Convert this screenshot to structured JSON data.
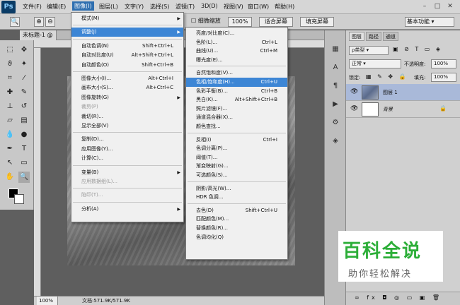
{
  "app": {
    "logo": "Ps"
  },
  "menubar": {
    "items": [
      "文件(F)",
      "编辑(E)",
      "图像(I)",
      "图层(L)",
      "文字(Y)",
      "选择(S)",
      "滤镜(T)",
      "3D(D)",
      "视图(V)",
      "窗口(W)",
      "帮助(H)"
    ],
    "active_index": 2
  },
  "optbar": {
    "zoom_value": "100%",
    "fine_zoom_label": "细微缩放",
    "fit_screen": "适合屏幕",
    "fill_screen": "填充屏幕",
    "workspace": "基本功能"
  },
  "document": {
    "tab_title": "未标题-1 @",
    "zoom": "100%",
    "doc_info": "文档:571.9K/571.9K"
  },
  "image_menu": {
    "items": [
      {
        "label": "模式(M)",
        "shortcut": "",
        "submenu": true,
        "disabled": false
      },
      {
        "sep": true
      },
      {
        "label": "调整(J)",
        "shortcut": "",
        "submenu": true,
        "disabled": false,
        "highlight": true
      },
      {
        "sep": true
      },
      {
        "label": "自动色调(N)",
        "shortcut": "Shift+Ctrl+L",
        "disabled": false
      },
      {
        "label": "自动对比度(U)",
        "shortcut": "Alt+Shift+Ctrl+L",
        "disabled": false
      },
      {
        "label": "自动颜色(O)",
        "shortcut": "Shift+Ctrl+B",
        "disabled": false
      },
      {
        "sep": true
      },
      {
        "label": "图像大小(I)...",
        "shortcut": "Alt+Ctrl+I",
        "disabled": false
      },
      {
        "label": "画布大小(S)...",
        "shortcut": "Alt+Ctrl+C",
        "disabled": false
      },
      {
        "label": "图像旋转(G)",
        "shortcut": "",
        "submenu": true,
        "disabled": false
      },
      {
        "label": "裁剪(P)",
        "shortcut": "",
        "disabled": true
      },
      {
        "label": "裁切(R)...",
        "shortcut": "",
        "disabled": false
      },
      {
        "label": "显示全部(V)",
        "shortcut": "",
        "disabled": false
      },
      {
        "sep": true
      },
      {
        "label": "复制(D)...",
        "shortcut": "",
        "disabled": false
      },
      {
        "label": "应用图像(Y)...",
        "shortcut": "",
        "disabled": false
      },
      {
        "label": "计算(C)...",
        "shortcut": "",
        "disabled": false
      },
      {
        "sep": true
      },
      {
        "label": "变量(B)",
        "shortcut": "",
        "submenu": true,
        "disabled": false
      },
      {
        "label": "应用数据组(L)...",
        "shortcut": "",
        "disabled": true
      },
      {
        "sep": true
      },
      {
        "label": "陷印(T)...",
        "shortcut": "",
        "disabled": true
      },
      {
        "sep": true
      },
      {
        "label": "分析(A)",
        "shortcut": "",
        "submenu": true,
        "disabled": false
      }
    ]
  },
  "adjust_menu": {
    "items": [
      {
        "label": "亮度/对比度(C)...",
        "shortcut": ""
      },
      {
        "label": "色阶(L)...",
        "shortcut": "Ctrl+L"
      },
      {
        "label": "曲线(U)...",
        "shortcut": "Ctrl+M"
      },
      {
        "label": "曝光度(E)...",
        "shortcut": ""
      },
      {
        "sep": true
      },
      {
        "label": "自然饱和度(V)...",
        "shortcut": ""
      },
      {
        "label": "色相/饱和度(H)...",
        "shortcut": "Ctrl+U",
        "highlight": true
      },
      {
        "label": "色彩平衡(B)...",
        "shortcut": "Ctrl+B"
      },
      {
        "label": "黑白(K)...",
        "shortcut": "Alt+Shift+Ctrl+B"
      },
      {
        "label": "照片滤镜(F)...",
        "shortcut": ""
      },
      {
        "label": "通道混合器(X)...",
        "shortcut": ""
      },
      {
        "label": "颜色查找...",
        "shortcut": ""
      },
      {
        "sep": true
      },
      {
        "label": "反相(I)",
        "shortcut": "Ctrl+I"
      },
      {
        "label": "色调分离(P)...",
        "shortcut": ""
      },
      {
        "label": "阈值(T)...",
        "shortcut": ""
      },
      {
        "label": "渐变映射(G)...",
        "shortcut": ""
      },
      {
        "label": "可选颜色(S)...",
        "shortcut": ""
      },
      {
        "sep": true
      },
      {
        "label": "阴影/高光(W)...",
        "shortcut": ""
      },
      {
        "label": "HDR 色调...",
        "shortcut": ""
      },
      {
        "sep": true
      },
      {
        "label": "去色(D)",
        "shortcut": "Shift+Ctrl+U"
      },
      {
        "label": "匹配颜色(M)...",
        "shortcut": ""
      },
      {
        "label": "替换颜色(R)...",
        "shortcut": ""
      },
      {
        "label": "色调均化(Q)",
        "shortcut": ""
      }
    ]
  },
  "layers_panel": {
    "tabs": [
      "图层",
      "路径",
      "通道"
    ],
    "filter_kind": "ρ类型",
    "blend_mode": "正常",
    "opacity_label": "不透明度:",
    "opacity_value": "100%",
    "lock_label": "锁定:",
    "fill_label": "填充:",
    "fill_value": "100%",
    "layers": [
      {
        "name": "图层 1",
        "selected": true
      },
      {
        "name": "背景",
        "selected": false,
        "locked": true
      }
    ],
    "footer_icons": "∞  fx  ◘  ◎  ▭  ▣  🗑"
  },
  "watermark": {
    "title": "百科全说",
    "subtitle": "助你轻松解决"
  },
  "colors": {
    "accent": "#3d86d5",
    "watermark_green": "#2cae38"
  }
}
